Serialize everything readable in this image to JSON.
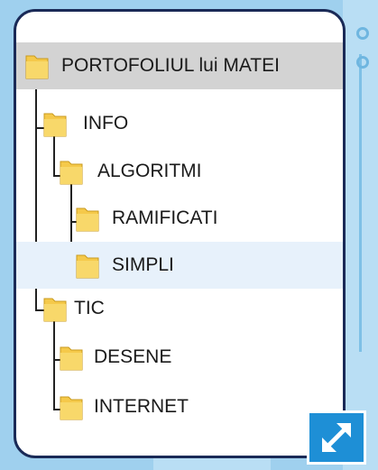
{
  "tree": {
    "root": "PORTOFOLIUL lui MATEI",
    "info": "INFO",
    "algoritmi": "ALGORITMI",
    "ramificati": "RAMIFICATI",
    "simpli": "SIMPLI",
    "tic": "TIC",
    "desene": "DESENE",
    "internet": "INTERNET"
  },
  "icons": {
    "folder": "folder-icon",
    "expand": "expand-arrows-icon"
  },
  "colors": {
    "background": "#9fd0ee",
    "panel_border": "#1a2a57",
    "folder": "#f5c94a",
    "selected_root": "#d3d3d3",
    "hover_row": "#e7f1fb",
    "expand_button": "#1e8fd6"
  }
}
